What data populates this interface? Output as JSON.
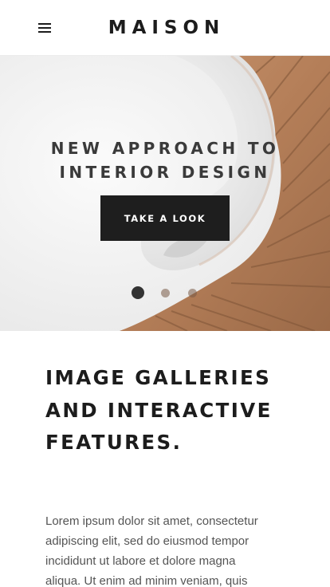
{
  "header": {
    "brand": "MAISON",
    "menu_icon": "hamburger-menu-icon"
  },
  "hero": {
    "title_lines": [
      "NEW APPROACH TO",
      "INTERIOR DESIGN"
    ],
    "cta_label": "TAKE A LOOK",
    "slides_count": 3,
    "active_slide": 1
  },
  "content": {
    "title_lines": [
      "IMAGE GALLERIES",
      "AND INTERACTIVE",
      "FEATURES."
    ],
    "body_lines": [
      "Lorem ipsum dolor sit amet, consectetur",
      "adipiscing elit, sed do eiusmod tempor",
      "incididunt ut labore et dolore magna",
      "aliqua. Ut enim ad minim veniam, quis"
    ]
  },
  "colors": {
    "text": "#1c1c1c",
    "button": "#1e1e1e",
    "wood": "#b98461"
  }
}
